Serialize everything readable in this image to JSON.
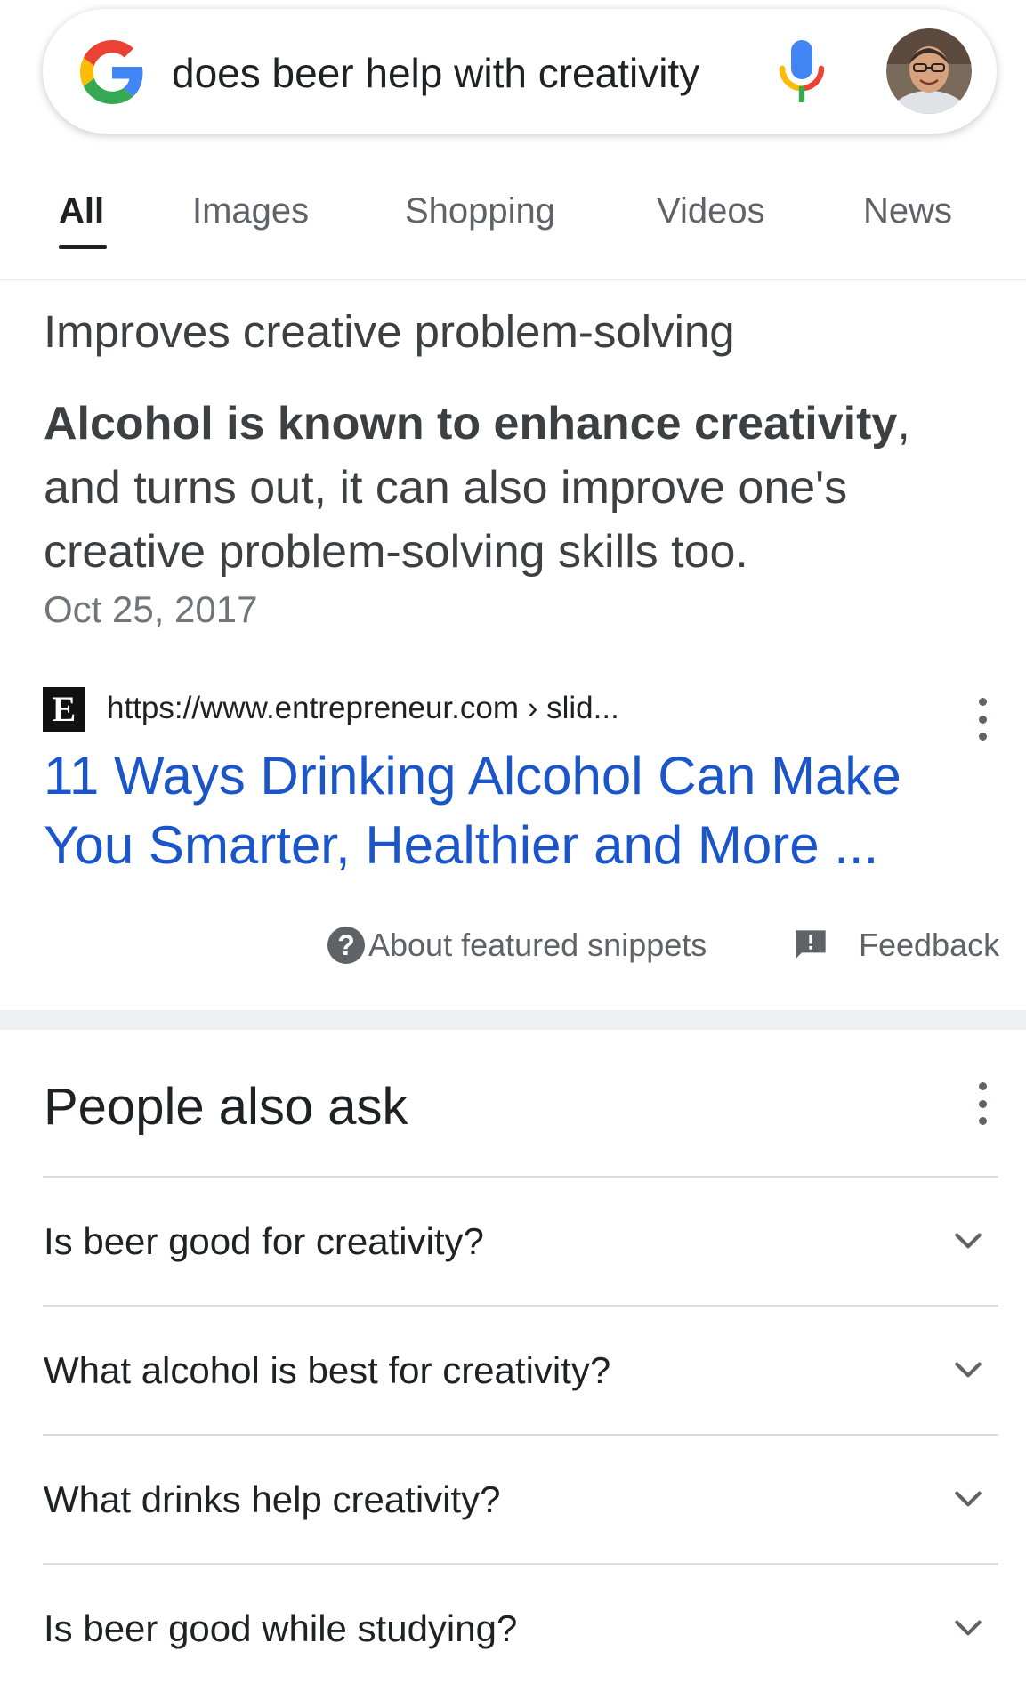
{
  "search": {
    "query": "does beer help with creativity",
    "logo_icon": "google-g-icon",
    "mic_icon": "microphone-icon",
    "avatar_icon": "user-avatar"
  },
  "tabs": [
    {
      "label": "All",
      "active": true
    },
    {
      "label": "Images",
      "active": false
    },
    {
      "label": "Shopping",
      "active": false
    },
    {
      "label": "Videos",
      "active": false
    },
    {
      "label": "News",
      "active": false
    }
  ],
  "featured_snippet": {
    "heading": "Improves creative problem-solving",
    "body_bold": "Alcohol is known to enhance creativity",
    "body_rest": ", and turns out, it can also improve one's creative problem-solving skills too.",
    "date": "Oct 25, 2017",
    "source_favicon_letter": "E",
    "source_url": "https://www.entrepreneur.com › slid...",
    "result_title": "11 Ways Drinking Alcohol Can Make You Smarter, Healthier and More ...",
    "about_label": "About featured snippets",
    "feedback_label": "Feedback"
  },
  "people_also_ask": {
    "title": "People also ask",
    "questions": [
      "Is beer good for creativity?",
      "What alcohol is best for creativity?",
      "What drinks help creativity?",
      "Is beer good while studying?"
    ]
  },
  "colors": {
    "link": "#1a56c9",
    "text_primary": "#202124",
    "text_secondary": "#5f6368",
    "divider": "#dadce0"
  }
}
